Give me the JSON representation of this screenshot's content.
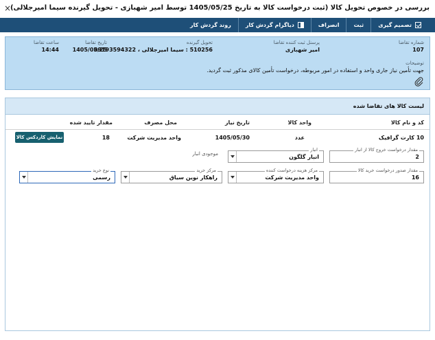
{
  "window": {
    "title": "بررسی در خصوص تحویل کالا (ثبت درخواست کالا به تاریخ 1405/05/25 توسط امیر شهبازی - تحویل گیرنده سیما امیرجلالی)",
    "close_glyph": "×"
  },
  "toolbar": {
    "items": [
      {
        "label": "تصمیم گیری",
        "icon": "checkbox-icon"
      },
      {
        "label": "ثبت",
        "icon": ""
      },
      {
        "label": "انصراف",
        "icon": ""
      },
      {
        "label": "دیاگرام گردش کار",
        "icon": "diagram-icon"
      },
      {
        "label": "روند گردش کار",
        "icon": ""
      }
    ]
  },
  "info": {
    "request_number": {
      "label": "شماره تقاضا",
      "value": "107"
    },
    "registrar": {
      "label": "پرسنل ثبت کننده تقاضا",
      "value": "امیر شهبازی"
    },
    "receiver": {
      "label": "تحویل گیرنده",
      "value": "510256 : سیما امیرجلالی ، 09193594322"
    },
    "request_date": {
      "label": "تاریخ تقاضا",
      "value": "1405/05/25"
    },
    "request_time": {
      "label": "ساعت تقاضا",
      "value": "14:44"
    },
    "description_label": "توضیحات",
    "description": "جهت تأمین نیاز جاری واحد و استفاده در امور مربوطه، درخواست تأمین کالای مذکور ثبت گردید."
  },
  "list": {
    "title": "لیست کالا های تقاضا شده",
    "columns": [
      "کد و نام کالا",
      "واحد کالا",
      "تاریخ نیاز",
      "محل مصرف",
      "مقدار تایید شده"
    ],
    "rows": [
      {
        "item": "10 کارت گرافیک",
        "unit": "عدد",
        "need_date": "1405/05/30",
        "usage": "واحد مدیریت شرکت",
        "approved": "18"
      }
    ],
    "kardex_button": "نمایش کاردکس کالا",
    "details": {
      "exit_qty": {
        "label": "مقدار درخواست خروج کالا از انبار",
        "value": "2"
      },
      "warehouse": {
        "label": "انبار",
        "value": "انبار گلگون"
      },
      "stock_label": "موجودی انبار",
      "purchase_qty": {
        "label": "مقدار صدور درخواست خرید کالا",
        "value": "16"
      },
      "cost_center": {
        "label": "مرکز هزینه درخواست کننده",
        "value": "واحد مدیریت شرکت"
      },
      "purchase_center": {
        "label": "مرکز خرید",
        "value": "راهکار نوین سیاق"
      },
      "purchase_type": {
        "label": "نوع خرید",
        "value": "رسمی"
      }
    }
  }
}
